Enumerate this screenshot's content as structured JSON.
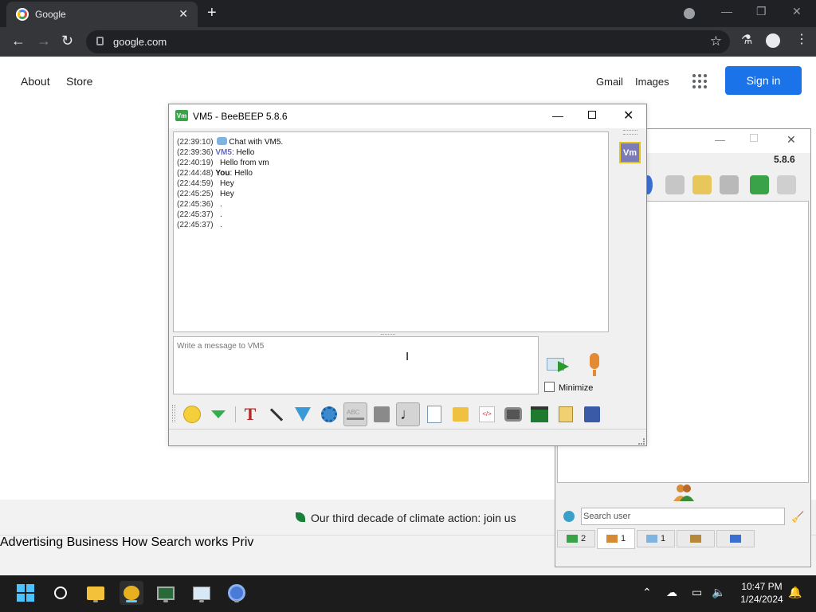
{
  "browser": {
    "tab_title": "Google",
    "url": "google.com",
    "new_tab_symbol": "+",
    "close_symbol": "✕"
  },
  "google": {
    "about": "About",
    "store": "Store",
    "gmail": "Gmail",
    "images": "Images",
    "sign_in": "Sign in",
    "climate": "Our third decade of climate action: join us",
    "footer_links": [
      "Advertising",
      "Business",
      "How Search works",
      "Priv"
    ]
  },
  "chat": {
    "window_title": "VM5 - BeeBEEP 5.8.6",
    "user_badge": "Vm",
    "messages": [
      {
        "time": "(22:39:10)",
        "who": "",
        "text": "Chat with VM5.",
        "system": true
      },
      {
        "time": "(22:39:36)",
        "who": "VM5",
        "text": ": Hello",
        "system": false
      },
      {
        "time": "(22:40:19)",
        "who": "",
        "text": "Hello from vm",
        "system": false
      },
      {
        "time": "(22:44:48)",
        "who": "You",
        "text": ": Hello",
        "system": false
      },
      {
        "time": "(22:44:59)",
        "who": "",
        "text": "Hey",
        "system": false
      },
      {
        "time": "(22:45:25)",
        "who": "",
        "text": "Hey",
        "system": false
      },
      {
        "time": "(22:45:36)",
        "who": "",
        "text": ".",
        "system": false
      },
      {
        "time": "(22:45:37)",
        "who": "",
        "text": ".",
        "system": false
      },
      {
        "time": "(22:45:37)",
        "who": "",
        "text": ".",
        "system": false
      }
    ],
    "compose_placeholder": "Write a message to VM5",
    "minimize_label": "Minimize"
  },
  "bbmain": {
    "version": "5.8.6",
    "search_placeholder": "Search user",
    "tabs": [
      {
        "label": "2"
      },
      {
        "label": "1"
      },
      {
        "label": "1"
      },
      {
        "label": ""
      },
      {
        "label": ""
      }
    ]
  },
  "taskbar": {
    "time": "10:47 PM",
    "date": "1/24/2024"
  },
  "colors": {
    "accent": "#1a73e8",
    "chrome_dark": "#202124",
    "beebeep_vm": "#7b7bb8"
  }
}
